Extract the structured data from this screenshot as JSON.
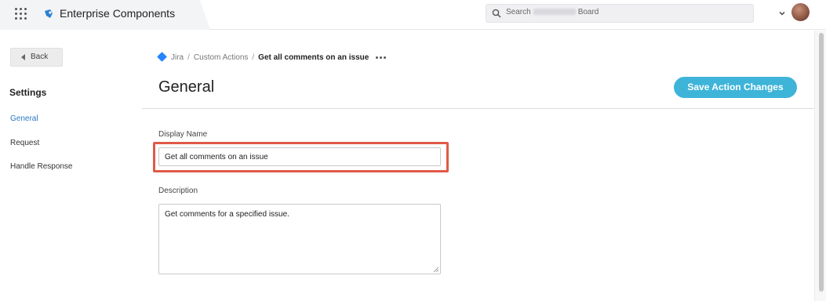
{
  "topbar": {
    "apps_icon": "grid-icon",
    "brand_icon": "brand-icon",
    "brand_title": "Enterprise Components",
    "search_placeholder_prefix": "Search",
    "search_placeholder_suffix": "Board",
    "dropdown_icon": "chevron-down-icon"
  },
  "sidebar": {
    "back_label": "Back",
    "heading": "Settings",
    "items": [
      {
        "label": "General",
        "active": true
      },
      {
        "label": "Request",
        "active": false
      },
      {
        "label": "Handle Response",
        "active": false
      }
    ]
  },
  "breadcrumb": {
    "root": "Jira",
    "sep": "/",
    "middle": "Custom Actions",
    "current": "Get all comments on an issue"
  },
  "main": {
    "title": "General",
    "save_label": "Save Action Changes",
    "display_name_label": "Display Name",
    "display_name_value": "Get all comments on an issue",
    "description_label": "Description",
    "description_value": "Get comments for a specified issue."
  },
  "colors": {
    "accent": "#3eb4d9",
    "active_link": "#2a79c4",
    "highlight": "#e05a47",
    "jira": "#2684ff"
  }
}
